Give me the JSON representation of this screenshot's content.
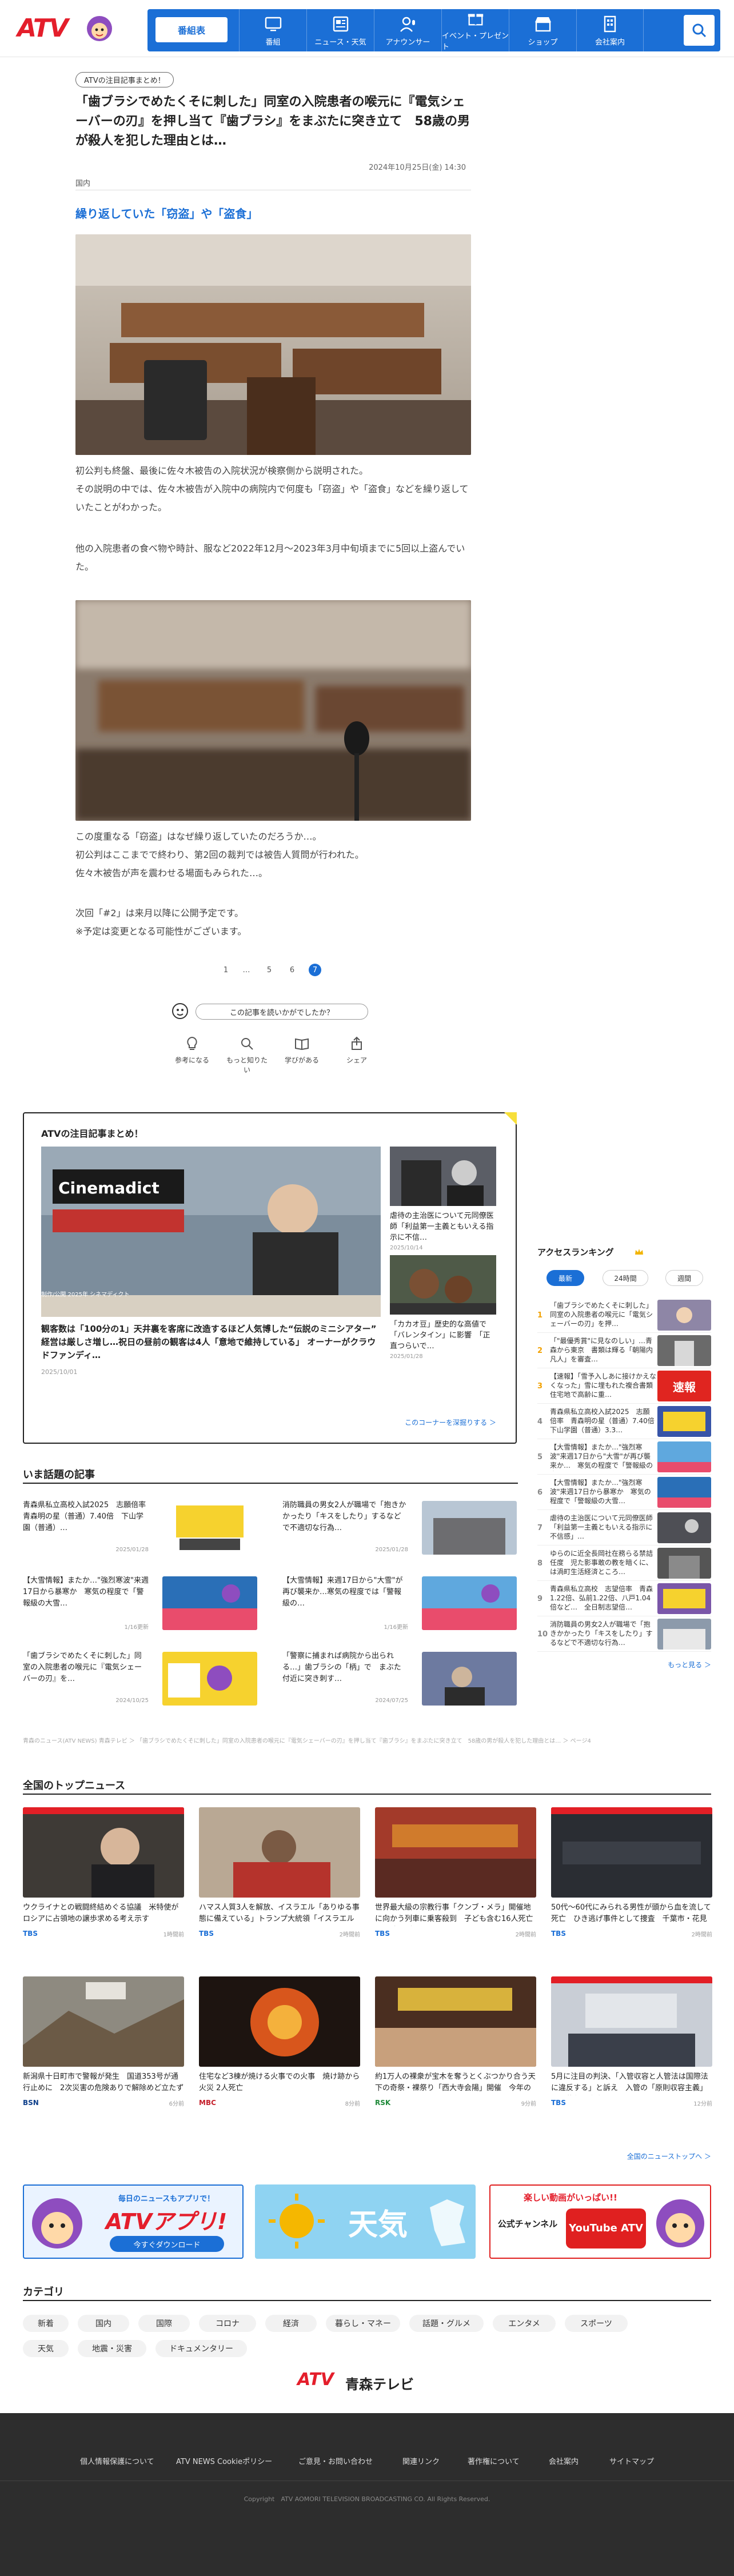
{
  "header": {
    "logo": "ATV",
    "nav": [
      {
        "label": "番組表",
        "icon": "program-list"
      },
      {
        "label": "番組",
        "icon": "tv-icon"
      },
      {
        "label": "ニュース・天気",
        "icon": "news-icon"
      },
      {
        "label": "アナウンサー",
        "icon": "announcer-icon"
      },
      {
        "label": "イベント・プレゼント",
        "icon": "event-icon"
      },
      {
        "label": "ショップ",
        "icon": "shop-icon"
      },
      {
        "label": "会社案内",
        "icon": "company-icon"
      }
    ]
  },
  "article": {
    "tag": "ATVの注目記事まとめ！",
    "title": "「歯ブラシでめたくそに刺した」同室の入院患者の喉元に『電気シェーバーの刃』を押し当て『歯ブラシ』をまぶたに突き立て　58歳の男が殺人を犯した理由とは…",
    "date": "2024年10月25日(金) 14:30",
    "category": "国内",
    "subheading": "繰り返していた「窃盗」や「盗食」",
    "paragraphs": [
      "初公判も終盤、最後に佐々木被告の入院状況が検察側から説明された。",
      "その説明の中では、佐々木被告が入院中の病院内で何度も「窃盗」や「盗食」などを繰り返していたことがわかった。",
      "他の入院患者の食べ物や時計、服など2022年12月～2023年3月中旬頃までに5回以上盗んでいた。",
      "この度重なる「窃盗」はなぜ繰り返していたのだろうか…。",
      "初公判はここまでで終わり、第2回の裁判では被告人質問が行われた。",
      "佐々木被告が声を震わせる場面もみられた…。",
      "次回「#2」は来月以降に公開予定です。",
      "※予定は変更となる可能性がございます。"
    ],
    "pagination": [
      "1",
      "…",
      "5",
      "6",
      "7"
    ],
    "feedback_label": "この記事を読いかがでしたか？",
    "reactions": [
      "参考になる",
      "もっと知りたい",
      "学びがある",
      "シェア"
    ]
  },
  "feature": {
    "heading": "ATVの注目記事まとめ！",
    "main_title": "観客数は「100分の1」天井裏を客席に改造するほど人気博した“伝説のミニシアター”　経営は厳しさ増し…祝日の昼前の観客は4人「意地で維持している」 オーナーがクラウドファンディ…",
    "main_date": "2025/10/01",
    "main_caption": "制作/公開 2025年 シネマディクト",
    "side": [
      {
        "title": "虐待の主治医について元同僚医師「利益第一主義ともいえる指示に不信…",
        "date": "2025/10/14"
      },
      {
        "title": "「カカオ豆」歴史的な高値で「バレンタイン」に影響　「正直つらいで…",
        "date": "2025/01/28"
      }
    ],
    "more": "このコーナーを深掘りする ＞"
  },
  "ranking": {
    "heading": "アクセスランキング",
    "tabs": [
      "最新",
      "24時間",
      "週間"
    ],
    "items": [
      {
        "num": "1",
        "title": "「歯ブラシでめたくそに刺した」同室の入院患者の喉元に「電気シェーバーの刃」を押…"
      },
      {
        "num": "2",
        "title": "「\"最優秀賞\"に見なのしい」…青森から東京　書類は輝る「朝陽内凡人」を審査…"
      },
      {
        "num": "3",
        "title": "【速報】「雪予入しあに接けかえなくなった」雪に埋もれた複合書類住宅地で高齢に重…"
      },
      {
        "num": "4",
        "title": "青森県私立高校入試2025　志願倍率　青森明の星（普通）7.40倍　下山学園（普通）3.3…"
      },
      {
        "num": "5",
        "title": "【大雪情報】またか…\"強烈寒波\"来週17日から\"大雪\"が再び襲来か…　寒気の程度で「警報級の大雪…"
      },
      {
        "num": "6",
        "title": "【大雪情報】またか…\"強烈寒波\"来週17日から暴寒か　寒気の程度で「警報級の大雪…"
      },
      {
        "num": "7",
        "title": "虐待の主治医について元同僚医師「利益第一主義ともいえる指示に不信感」…"
      },
      {
        "num": "8",
        "title": "ゆらのに近全長岡社在務らる禁詰任度　児た影事敢の教を暗くに、は渦町生活経済ところ…"
      },
      {
        "num": "9",
        "title": "青森県私立高校　志望倍率　青森1.22倍、弘前1.22倍、八戸1.04倍など…　全日制志望倍…"
      },
      {
        "num": "10",
        "title": "消防職員の男女2人が職場で「抱きかかったり「キスをしたり」するなどで不適切な行為…"
      }
    ],
    "more": "もっと見る ＞"
  },
  "topics": {
    "heading": "いま話題の記事",
    "items": [
      {
        "title": "青森県私立高校入試2025　志願倍率　青森明の星（普通）7.40倍　下山学園（普通）…",
        "date": "2025/01/28"
      },
      {
        "title": "消防職員の男女2人が職場で「抱きかかったり「キスをしたり」するなどで不適切な行為…",
        "date": "2025/01/28"
      },
      {
        "title": "【大雪情報】またか…\"強烈寒波\"来週17日から暴寒か　寒気の程度で「警報級の大雪…",
        "date": "1/16更新"
      },
      {
        "title": "【大雪情報】来週17日から\"大雪\"が再び襲来か…寒気の程度では「警報級の…",
        "date": "1/16更新"
      },
      {
        "title": "「歯ブラシでめたくそに刺した」同室の入院患者の喉元に『電気シェーバーの刃』を…",
        "date": "2024/10/25"
      },
      {
        "title": "「警察に捕まれば病院から出られる…」歯ブラシの「柄」で　まぶた付近に突き刺す…",
        "date": "2024/07/25"
      }
    ],
    "breadcrumb": "青森のニュース(ATV NEWS) 青森テレビ ＞ 「歯ブラシでめたくそに刺した」同室の入院患者の喉元に『電気シェーバーの刃』を押し当て『歯ブラシ』をまぶたに突き立て　58歳の男が殺人を犯した理由とは… ＞ ページ4"
  },
  "national": {
    "heading": "全国のトップニュース",
    "items": [
      {
        "title": "ウクライナとの戦闘終結めぐる協議　米特使がロシアに占領地の譲歩求める考え示す",
        "source": "TBS",
        "date": "1時間前"
      },
      {
        "title": "ハマス人質3人を解放、イスラエル「ありゆる事態に備えている」トランプ大統領「イスラエルは今後につい…",
        "source": "TBS",
        "date": "2時間前"
      },
      {
        "title": "世界最大級の宗教行事「クンブ・メラ」開催地に向かう列車に乗客殺到　子ども含む16人死亡と現地メディア…",
        "source": "TBS",
        "date": "2時間前"
      },
      {
        "title": "50代〜60代にみられる男性が頭から血を流して死亡　ひき逃げ事件として捜査　千葉市・花見川区",
        "source": "TBS",
        "date": "2時間前"
      },
      {
        "title": "新潟県十日町市で警報が発生　国道353号が通行止めに　2次災害の危険ありで解除めど立たず",
        "source": "BSN",
        "date": "6分前"
      },
      {
        "title": "住宅など3棟が焼ける火事での火事　焼け跡から火災 2人死亡",
        "source": "MBC",
        "date": "8分前"
      },
      {
        "title": "約1万人の裸衆が宝木を奪うとくぶつかり合う天下の奇祭・裸祭り「西大寺会陽」開催　今年の福男が決まる【岡山】",
        "source": "RSK",
        "date": "9分前"
      },
      {
        "title": "5月に注目の判決、「入管収容と人管法は国際法に違反する」と訴え　入管の「原則収容主義」巡る裁判【東京】",
        "source": "TBS",
        "date": "12分前"
      }
    ],
    "more": "全国のニューストップへ ＞"
  },
  "banners": [
    {
      "line1": "毎日のニュースもアプリで！",
      "line2": "ATVアプリ!",
      "line3": "今すぐダウンロード"
    },
    {
      "line1": "天気"
    },
    {
      "line1": "楽しい動画がいっぱい!!",
      "line2": "公式チャンネル",
      "line3": "YouTube ATV"
    }
  ],
  "categories": {
    "heading": "カテゴリ",
    "items": [
      "新着",
      "国内",
      "国際",
      "コロナ",
      "経済",
      "暮らし・マネー",
      "話題・グルメ",
      "エンタメ",
      "スポーツ",
      "天気",
      "地震・災害",
      "ドキュメンタリー"
    ]
  },
  "brand": {
    "mark": "ATV",
    "name": "青森テレビ"
  },
  "footer": {
    "links": [
      "個人情報保護について",
      "ATV NEWS Cookieポリシー",
      "ご意見・お問い合わせ",
      "関連リンク",
      "著作権について",
      "会社案内",
      "サイトマップ"
    ],
    "copyright": "Copyright　ATV AOMORI TELEVISION BROADCASTING CO. All Rights Reserved."
  },
  "colors": {
    "accent": "#1b6fd6",
    "brand_red": "#e41e2b",
    "highlight": "#f7df3a"
  }
}
